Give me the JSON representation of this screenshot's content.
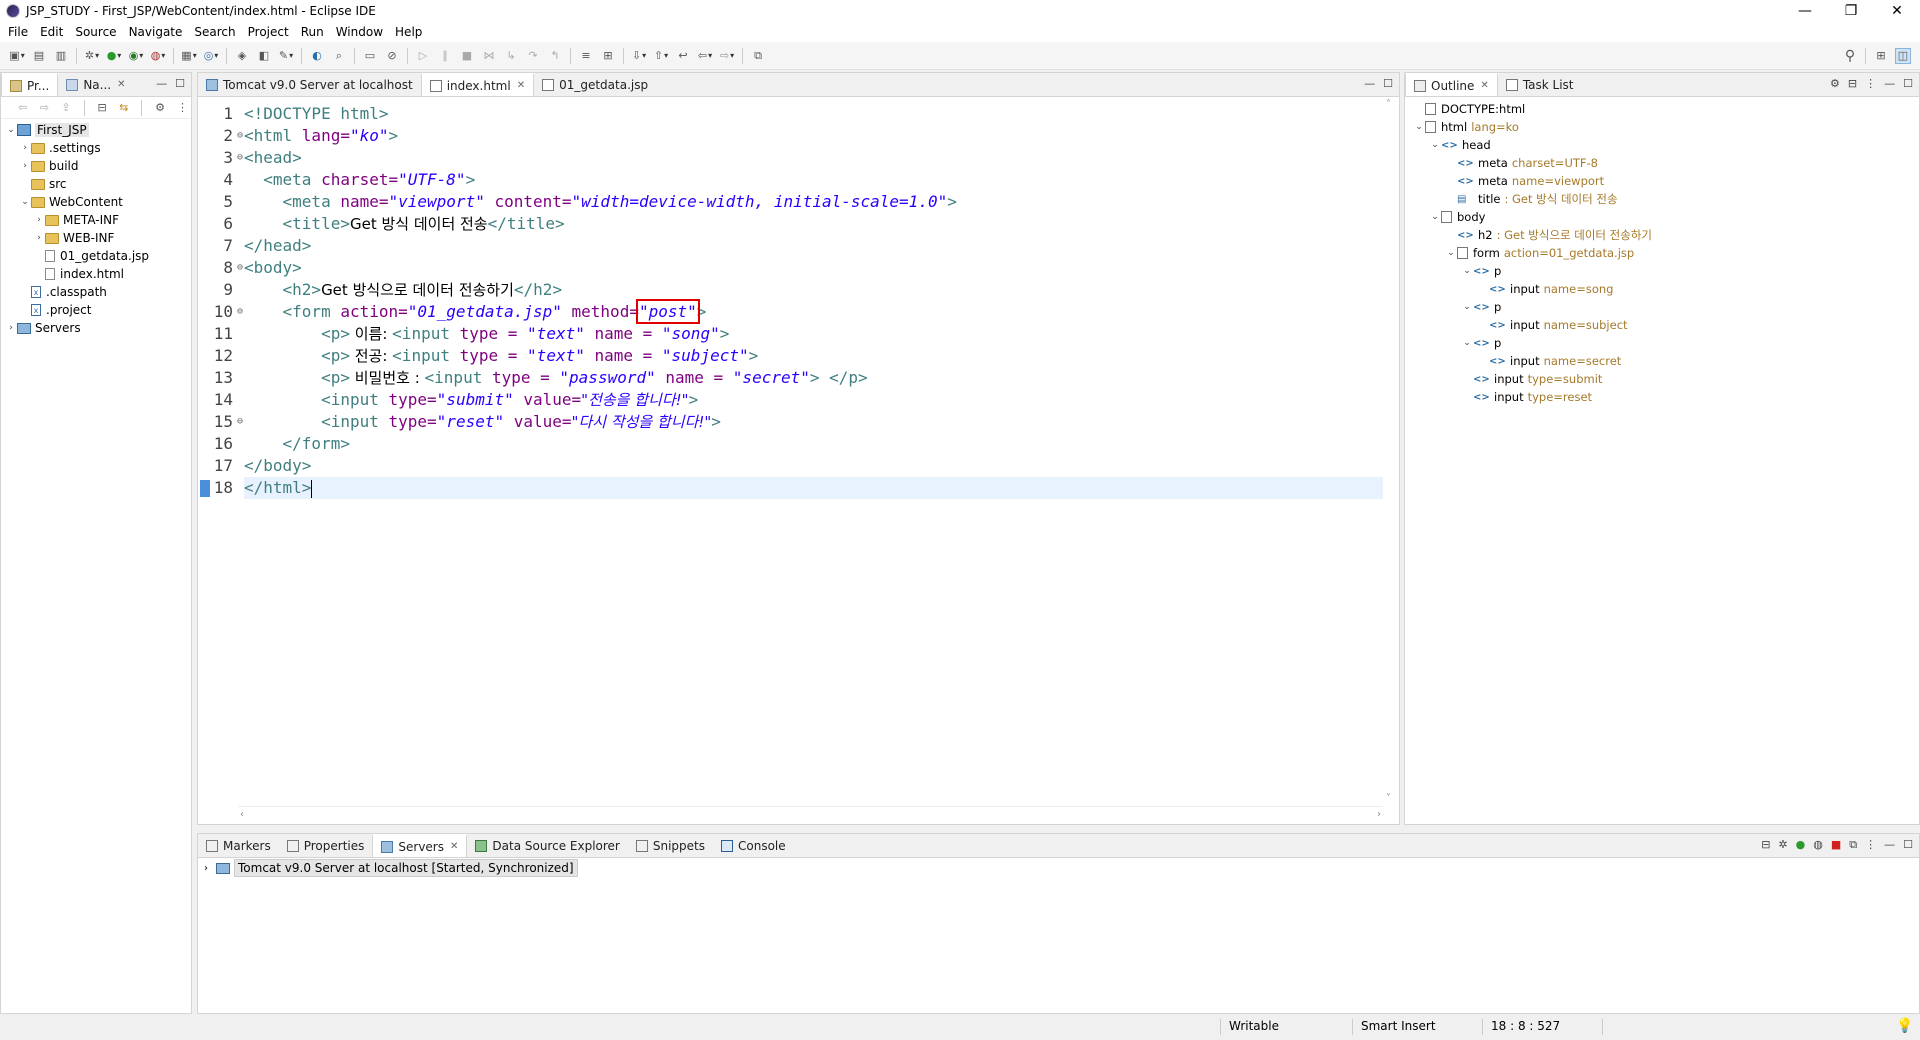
{
  "window": {
    "title": "JSP_STUDY - First_JSP/WebContent/index.html - Eclipse IDE",
    "minimize": "—",
    "restore": "❐",
    "close": "✕"
  },
  "menu": [
    "File",
    "Edit",
    "Source",
    "Navigate",
    "Search",
    "Project",
    "Run",
    "Window",
    "Help"
  ],
  "explorer": {
    "tabs": [
      {
        "label": "Pr..."
      },
      {
        "label": "Na..."
      }
    ],
    "tree": [
      {
        "label": "First_JSP",
        "depth": 0,
        "type": "project",
        "expanded": true
      },
      {
        "label": ".settings",
        "depth": 1,
        "type": "folder",
        "expanded": false
      },
      {
        "label": "build",
        "depth": 1,
        "type": "folder",
        "expanded": false
      },
      {
        "label": "src",
        "depth": 1,
        "type": "folder",
        "expanded": null
      },
      {
        "label": "WebContent",
        "depth": 1,
        "type": "folder",
        "expanded": true
      },
      {
        "label": "META-INF",
        "depth": 2,
        "type": "folder",
        "expanded": false
      },
      {
        "label": "WEB-INF",
        "depth": 2,
        "type": "folder",
        "expanded": false
      },
      {
        "label": "01_getdata.jsp",
        "depth": 2,
        "type": "file",
        "expanded": null
      },
      {
        "label": "index.html",
        "depth": 2,
        "type": "file",
        "expanded": null
      },
      {
        "label": ".classpath",
        "depth": 1,
        "type": "xml",
        "expanded": null
      },
      {
        "label": ".project",
        "depth": 1,
        "type": "xml",
        "expanded": null
      },
      {
        "label": "Servers",
        "depth": 0,
        "type": "servers",
        "expanded": false
      }
    ]
  },
  "editor": {
    "tabs": [
      {
        "label": "Tomcat v9.0 Server at localhost",
        "active": false,
        "closable": false
      },
      {
        "label": "index.html",
        "active": true,
        "closable": true
      },
      {
        "label": "01_getdata.jsp",
        "active": false,
        "closable": false
      }
    ],
    "lines": [
      {
        "n": "1",
        "fold": ""
      },
      {
        "n": "2",
        "fold": "⊖"
      },
      {
        "n": "3",
        "fold": "⊖"
      },
      {
        "n": "4",
        "fold": ""
      },
      {
        "n": "5",
        "fold": ""
      },
      {
        "n": "6",
        "fold": ""
      },
      {
        "n": "7",
        "fold": ""
      },
      {
        "n": "8",
        "fold": "⊖"
      },
      {
        "n": "9",
        "fold": ""
      },
      {
        "n": "10",
        "fold": "⊖"
      },
      {
        "n": "11",
        "fold": ""
      },
      {
        "n": "12",
        "fold": ""
      },
      {
        "n": "13",
        "fold": ""
      },
      {
        "n": "14",
        "fold": ""
      },
      {
        "n": "15",
        "fold": "⊖"
      },
      {
        "n": "16",
        "fold": ""
      },
      {
        "n": "17",
        "fold": ""
      },
      {
        "n": "18",
        "fold": ""
      }
    ],
    "code": {
      "l1": "<!DOCTYPE html>",
      "l2_tag": "<html ",
      "l2_attr": "lang=",
      "l2_val": "\"ko\"",
      "l2_end": ">",
      "l3": "<head>",
      "l4_tag": "  <meta ",
      "l4_attr": "charset=",
      "l4_val": "\"UTF-8\"",
      "l4_end": ">",
      "l5_tag": "    <meta ",
      "l5_attr1": "name=",
      "l5_val1": "\"viewport\"",
      "l5_attr2": " content=",
      "l5_val2": "\"width=device-width, initial-scale=1.0\"",
      "l5_end": ">",
      "l6_open": "    <title>",
      "l6_text": "Get 방식 데이터 전송",
      "l6_close": "</title>",
      "l7": "</head>",
      "l8": "<body>",
      "l9_open": "    <h2>",
      "l9_text": "Get 방식으로 데이터 전송하기",
      "l9_close": "</h2>",
      "l10_tag": "    <form ",
      "l10_attr1": "action=",
      "l10_val1": "\"01_getdata.jsp\"",
      "l10_attr2": " method=",
      "l10_val2": "\"post\"",
      "l10_end": ">",
      "l11_p": "        <p>",
      "l11_text": " 이름: ",
      "l11_tag": "<input ",
      "l11_a1": "type = ",
      "l11_v1": "\"text\"",
      "l11_a2": " name = ",
      "l11_v2": "\"song\"",
      "l11_end": ">",
      "l12_p": "        <p>",
      "l12_text": " 전공: ",
      "l12_tag": "<input ",
      "l12_a1": "type = ",
      "l12_v1": "\"text\"",
      "l12_a2": " name = ",
      "l12_v2": "\"subject\"",
      "l12_end": ">",
      "l13_p": "        <p>",
      "l13_text": " 비밀번호 : ",
      "l13_tag": "<input ",
      "l13_a1": "type = ",
      "l13_v1": "\"password\"",
      "l13_a2": " name = ",
      "l13_v2": "\"secret\"",
      "l13_end": "> </p>",
      "l14_tag": "        <input ",
      "l14_a1": "type=",
      "l14_v1": "\"submit\"",
      "l14_a2": " value=",
      "l14_v2": "\"전송을 합니다!\"",
      "l14_end": ">",
      "l15_tag": "        <input ",
      "l15_a1": "type=",
      "l15_v1": "\"reset\"",
      "l15_a2": " value=",
      "l15_v2": "\"다시 작성을 합니다!\"",
      "l15_end": ">",
      "l16": "    </form>",
      "l17": "</body>",
      "l18": "</html>"
    }
  },
  "outline": {
    "tabs": [
      {
        "label": "Outline",
        "closable": true
      },
      {
        "label": "Task List",
        "closable": false
      }
    ],
    "tree": [
      {
        "name": "DOCTYPE:html",
        "detail": "",
        "depth": 0,
        "icon": "doc",
        "twisty": ""
      },
      {
        "name": "html",
        "detail": "lang=ko",
        "depth": 0,
        "icon": "doc",
        "twisty": "⌄"
      },
      {
        "name": "head",
        "detail": "",
        "depth": 1,
        "icon": "tag",
        "twisty": "⌄"
      },
      {
        "name": "meta",
        "detail": "charset=UTF-8",
        "depth": 2,
        "icon": "tag",
        "twisty": ""
      },
      {
        "name": "meta",
        "detail": "name=viewport",
        "depth": 2,
        "icon": "tag",
        "twisty": ""
      },
      {
        "name": "title",
        "detail": ": Get 방식 데이터 전송",
        "depth": 2,
        "icon": "title",
        "twisty": ""
      },
      {
        "name": "body",
        "detail": "",
        "depth": 1,
        "icon": "doc",
        "twisty": "⌄"
      },
      {
        "name": "h2",
        "detail": ": Get 방식으로 데이터 전송하기",
        "depth": 2,
        "icon": "tag",
        "twisty": ""
      },
      {
        "name": "form",
        "detail": "action=01_getdata.jsp",
        "depth": 2,
        "icon": "doc",
        "twisty": "⌄"
      },
      {
        "name": "p",
        "detail": "",
        "depth": 3,
        "icon": "tag",
        "twisty": "⌄"
      },
      {
        "name": "input",
        "detail": "name=song",
        "depth": 4,
        "icon": "tag",
        "twisty": ""
      },
      {
        "name": "p",
        "detail": "",
        "depth": 3,
        "icon": "tag",
        "twisty": "⌄"
      },
      {
        "name": "input",
        "detail": "name=subject",
        "depth": 4,
        "icon": "tag",
        "twisty": ""
      },
      {
        "name": "p",
        "detail": "",
        "depth": 3,
        "icon": "tag",
        "twisty": "⌄"
      },
      {
        "name": "input",
        "detail": "name=secret",
        "depth": 4,
        "icon": "tag",
        "twisty": ""
      },
      {
        "name": "input",
        "detail": "type=submit",
        "depth": 3,
        "icon": "tag",
        "twisty": ""
      },
      {
        "name": "input",
        "detail": "type=reset",
        "depth": 3,
        "icon": "tag",
        "twisty": ""
      }
    ]
  },
  "bottom": {
    "tabs": [
      {
        "label": "Markers"
      },
      {
        "label": "Properties"
      },
      {
        "label": "Servers",
        "active": true
      },
      {
        "label": "Data Source Explorer"
      },
      {
        "label": "Snippets"
      },
      {
        "label": "Console"
      }
    ],
    "server_row": "Tomcat v9.0 Server at localhost  [Started, Synchronized]"
  },
  "status": {
    "mode": "Writable",
    "insert": "Smart Insert",
    "position": "18 : 8 : 527"
  },
  "colors": {
    "tag": "#3f7f7f",
    "attribute": "#7f007f",
    "value": "#2a00ff",
    "highlight_box": "#e00000",
    "current_line": "#e8f2fe"
  }
}
